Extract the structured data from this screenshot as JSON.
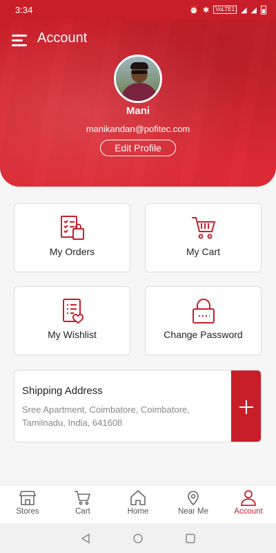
{
  "status_bar": {
    "time": "3:34",
    "lte": "VoLTE1"
  },
  "header": {
    "title": "Account"
  },
  "profile": {
    "name": "Mani",
    "email": "manikandan@pofitec.com",
    "edit_label": "Edit Profile"
  },
  "cards": [
    {
      "label": "My Orders",
      "icon": "orders-icon"
    },
    {
      "label": "My Cart",
      "icon": "cart-icon"
    },
    {
      "label": "My Wishlist",
      "icon": "wishlist-icon"
    },
    {
      "label": "Change Password",
      "icon": "lock-icon"
    }
  ],
  "shipping": {
    "title": "Shipping Address",
    "address": "Sree Apartment, Coimbatore, Coimbatore, Tamilnadu, India, 641608"
  },
  "nav": [
    {
      "label": "Stores",
      "icon": "store-icon"
    },
    {
      "label": "Cart",
      "icon": "cart-icon"
    },
    {
      "label": "Home",
      "icon": "home-icon"
    },
    {
      "label": "Near Me",
      "icon": "location-pin-icon"
    },
    {
      "label": "Account",
      "icon": "user-icon",
      "active": true
    }
  ],
  "colors": {
    "accent": "#c81e2a"
  }
}
